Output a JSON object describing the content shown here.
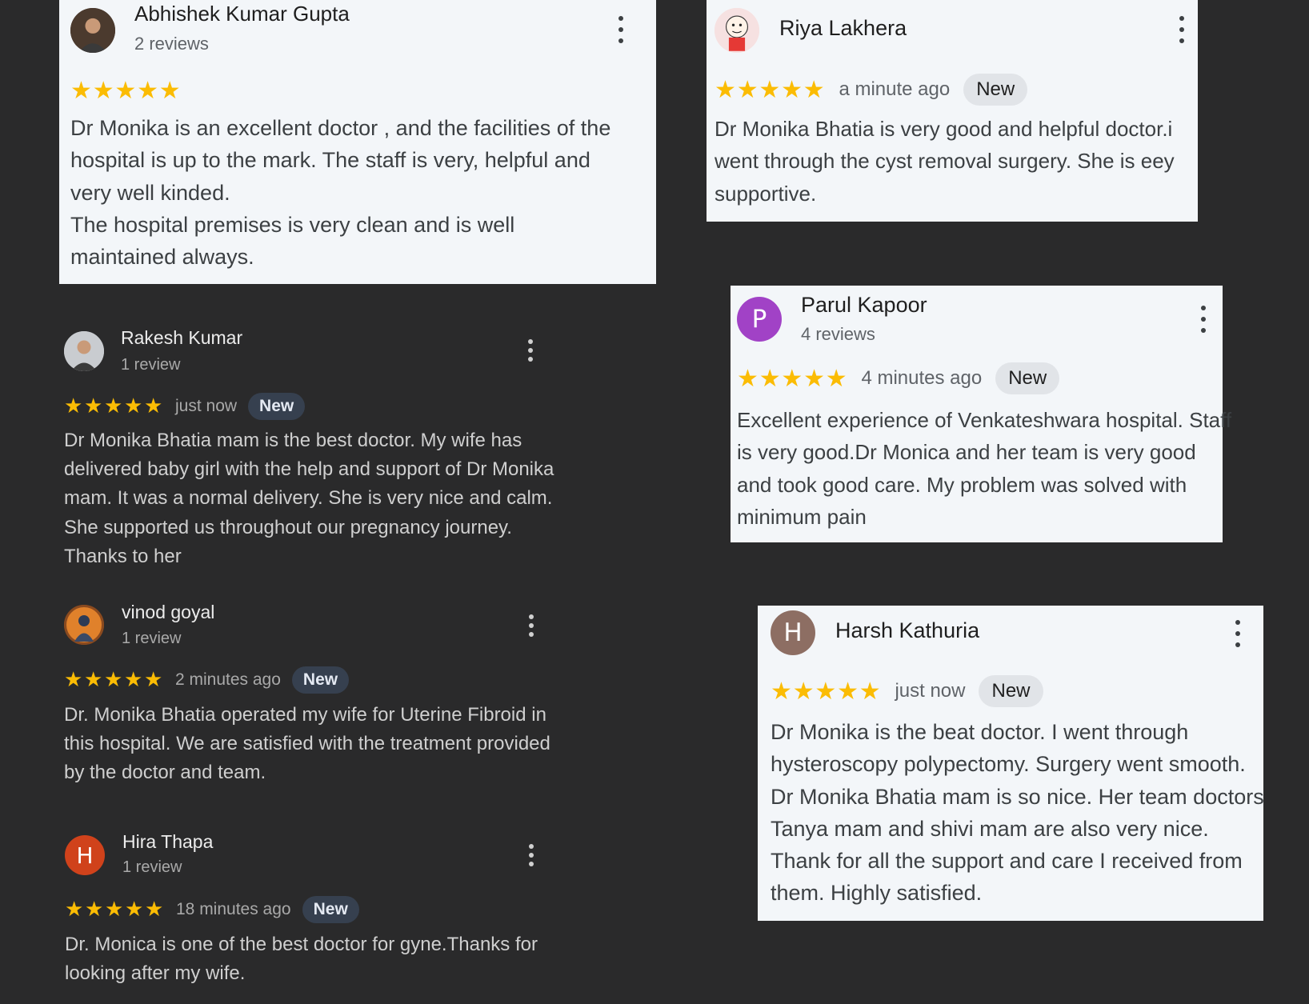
{
  "reviews": [
    {
      "name": "Abhishek Kumar Gupta",
      "meta": "2 reviews",
      "time": "",
      "badge": "",
      "avatar": {
        "type": "photo",
        "icon": "person-photo-icon",
        "bg": "#4b3a2e"
      },
      "paragraphs": [
        "Dr Monika is an excellent doctor , and the facilities of the hospital is up to the mark. The staff is very, helpful and very well kinded.",
        "The hospital premises is very clean and is well maintained always."
      ]
    },
    {
      "name": "Riya Lakhera",
      "meta": "",
      "time": "a minute ago",
      "badge": "New",
      "avatar": {
        "type": "photo",
        "icon": "cartoon-avatar-icon",
        "bg": "#f6e1e1"
      },
      "paragraphs": [
        "Dr Monika Bhatia is very good and helpful doctor.i went through the cyst removal surgery. She is eey supportive."
      ]
    },
    {
      "name": "Rakesh Kumar",
      "meta": "1 review",
      "time": "just now",
      "badge": "New",
      "avatar": {
        "type": "photo",
        "icon": "person-photo-icon",
        "bg": "#c9ccd0"
      },
      "paragraphs": [
        "Dr Monika Bhatia mam is the best doctor. My wife has delivered baby girl with the help and support of Dr Monika mam. It was a normal delivery. She is very nice and calm. She supported us throughout our pregnancy journey. Thanks to her"
      ]
    },
    {
      "name": "Parul Kapoor",
      "meta": "4 reviews",
      "time": "4 minutes ago",
      "badge": "New",
      "avatar": {
        "type": "letter",
        "letter": "P",
        "bg": "#a142c6"
      },
      "paragraphs": [
        "Excellent experience of Venkateshwara hospital. Staff is very good.Dr Monica and her team is very good and took good care. My problem was solved with minimum pain"
      ]
    },
    {
      "name": "vinod goyal",
      "meta": "1 review",
      "time": "2 minutes ago",
      "badge": "New",
      "avatar": {
        "type": "photo",
        "icon": "deity-photo-icon",
        "bg": "#8a4a1f"
      },
      "paragraphs": [
        "Dr. Monika Bhatia operated my wife for Uterine Fibroid in this hospital. We are satisfied with the treatment provided by the doctor and team."
      ]
    },
    {
      "name": "Harsh Kathuria",
      "meta": "",
      "time": "just now",
      "badge": "New",
      "avatar": {
        "type": "letter",
        "letter": "H",
        "bg": "#8d6e63"
      },
      "paragraphs": [
        "Dr Monika is the beat doctor. I went through hysteroscopy polypectomy. Surgery went smooth. Dr Monika Bhatia mam is so nice. Her team doctors Tanya mam and shivi mam are also very nice. Thank for all the support and care I received from them. Highly satisfied."
      ]
    },
    {
      "name": "Hira Thapa",
      "meta": "1 review",
      "time": "18 minutes ago",
      "badge": "New",
      "avatar": {
        "type": "letter",
        "letter": "H",
        "bg": "#d0421b"
      },
      "paragraphs": [
        "Dr. Monica is one of the best doctor for gyne.Thanks for looking after my wife."
      ]
    }
  ],
  "rating": {
    "stars": 5,
    "max": 5,
    "color": "#fbbc04"
  },
  "icons": {
    "more": "more-vert-icon",
    "star": "star-icon"
  },
  "colors": {
    "background": "#2a2a2b",
    "light_card": "#f3f6f9"
  }
}
